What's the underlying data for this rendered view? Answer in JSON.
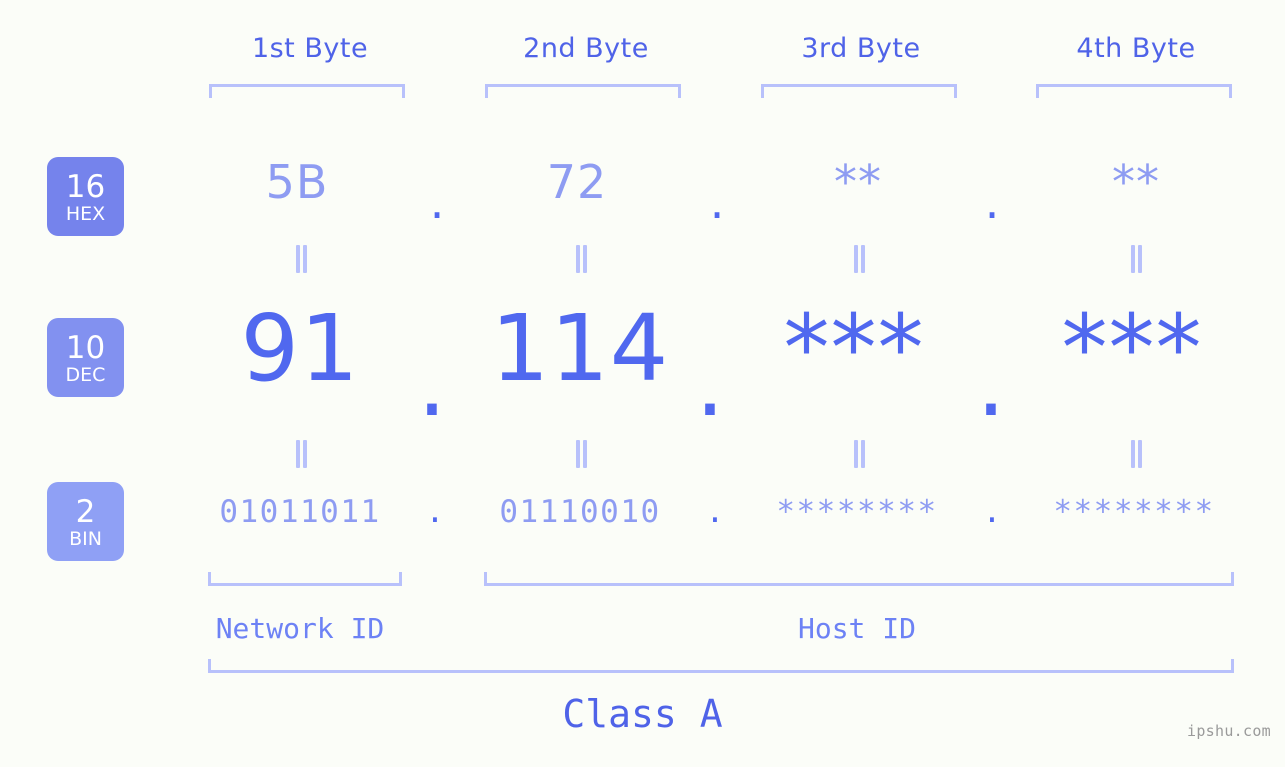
{
  "background_color": "#fbfdf8",
  "accent_colors": {
    "strong_blue": "#5068ef",
    "mid_blue": "#8e9cf2",
    "light_blue": "#b8c1fb",
    "header_blue": "#4f63e8",
    "badge_hex": "#7583ec",
    "badge_dec": "#8291f0",
    "badge_bin": "#8fa0f5",
    "watermark_gray": "#9a9a9a"
  },
  "headers": [
    {
      "label": "1st Byte"
    },
    {
      "label": "2nd Byte"
    },
    {
      "label": "3rd Byte"
    },
    {
      "label": "4th Byte"
    }
  ],
  "rows": [
    {
      "id": "hex",
      "badge": {
        "number": "16",
        "name": "HEX"
      },
      "values": [
        "5B",
        "72",
        "**",
        "**"
      ],
      "separators": [
        ".",
        ".",
        "."
      ]
    },
    {
      "id": "dec",
      "badge": {
        "number": "10",
        "name": "DEC"
      },
      "values": [
        "91",
        "114",
        "***",
        "***"
      ],
      "separators": [
        ".",
        ".",
        "."
      ]
    },
    {
      "id": "bin",
      "badge": {
        "number": "2",
        "name": "BIN"
      },
      "values": [
        "01011011",
        "01110010",
        "********",
        "********"
      ],
      "separators": [
        ".",
        ".",
        "."
      ]
    }
  ],
  "connectors": {
    "glyph": "||",
    "count_per_row_gap": 4
  },
  "sections": {
    "network_id": "Network ID",
    "host_id": "Host ID",
    "class": "Class A"
  },
  "watermark": "ipshu.com"
}
